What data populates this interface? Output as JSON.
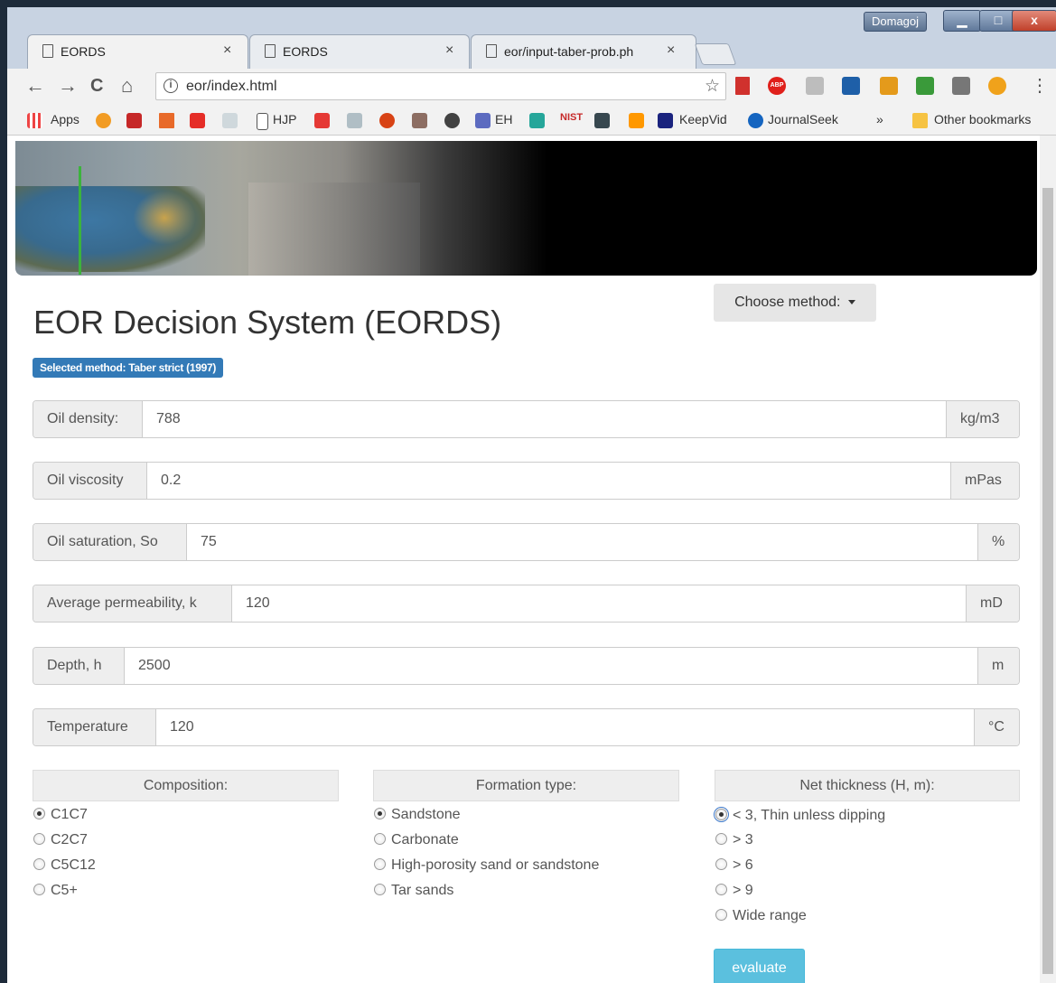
{
  "window": {
    "user": "Domagoj",
    "minimize_label": "▁",
    "maximize_label": "□",
    "close_label": "x"
  },
  "tabs": [
    {
      "label": "EORDS",
      "close": "×"
    },
    {
      "label": "EORDS",
      "close": "×"
    },
    {
      "label": "eor/input-taber-prob.ph",
      "close": "×"
    }
  ],
  "toolbar": {
    "back": "←",
    "forward": "→",
    "reload": "C",
    "home": "⌂",
    "url": "eor/index.html",
    "info": "i",
    "star": "☆",
    "menu": "⋮"
  },
  "extensions": [
    {
      "icon": "bookmark-red-icon",
      "color": "#d0312d"
    },
    {
      "icon": "adblock-icon",
      "color": "#e0201b",
      "text": "ABP"
    },
    {
      "icon": "drive-icon",
      "color": "#bdbdbd"
    },
    {
      "icon": "reader-icon",
      "color": "#1e5fa8"
    },
    {
      "icon": "tools-icon",
      "color": "#e49a1b"
    },
    {
      "icon": "frog-icon",
      "color": "#3a9a3a"
    },
    {
      "icon": "box-icon",
      "color": "#777777"
    },
    {
      "icon": "bird-icon",
      "color": "#f0a21b"
    }
  ],
  "bookmarks": {
    "apps": "Apps",
    "hjp": "HJP",
    "eh": "EH",
    "nist": "NIST",
    "keepvid": "KeepVid",
    "journalseek": "JournalSeek",
    "more": "»",
    "other": "Other bookmarks"
  },
  "page": {
    "choose_method": "Choose method:",
    "title": "EOR Decision System (EORDS)",
    "selected_method": "Selected method: Taber strict (1997)",
    "fields": [
      {
        "label": "Oil density:",
        "value": "788",
        "unit": "kg/m3"
      },
      {
        "label": "Oil viscosity",
        "value": "0.2",
        "unit": "mPas"
      },
      {
        "label": "Oil saturation, So",
        "value": "75",
        "unit": "%"
      },
      {
        "label": "Average permeability, k",
        "value": "120",
        "unit": "mD"
      },
      {
        "label": "Depth, h",
        "value": "2500",
        "unit": "m"
      },
      {
        "label": "Temperature",
        "value": "120",
        "unit": "°C"
      }
    ],
    "composition": {
      "heading": "Composition:",
      "options": [
        "C1C7",
        "C2C7",
        "C5C12",
        "C5+"
      ],
      "selected": 0
    },
    "formation": {
      "heading": "Formation type:",
      "options": [
        "Sandstone",
        "Carbonate",
        "High-porosity sand or sandstone",
        "Tar sands"
      ],
      "selected": 0
    },
    "thickness": {
      "heading": "Net thickness (H, m):",
      "options": [
        "< 3, Thin unless dipping",
        "> 3",
        "> 6",
        "> 9",
        "Wide range"
      ],
      "selected": 0
    },
    "evaluate": "evaluate"
  }
}
